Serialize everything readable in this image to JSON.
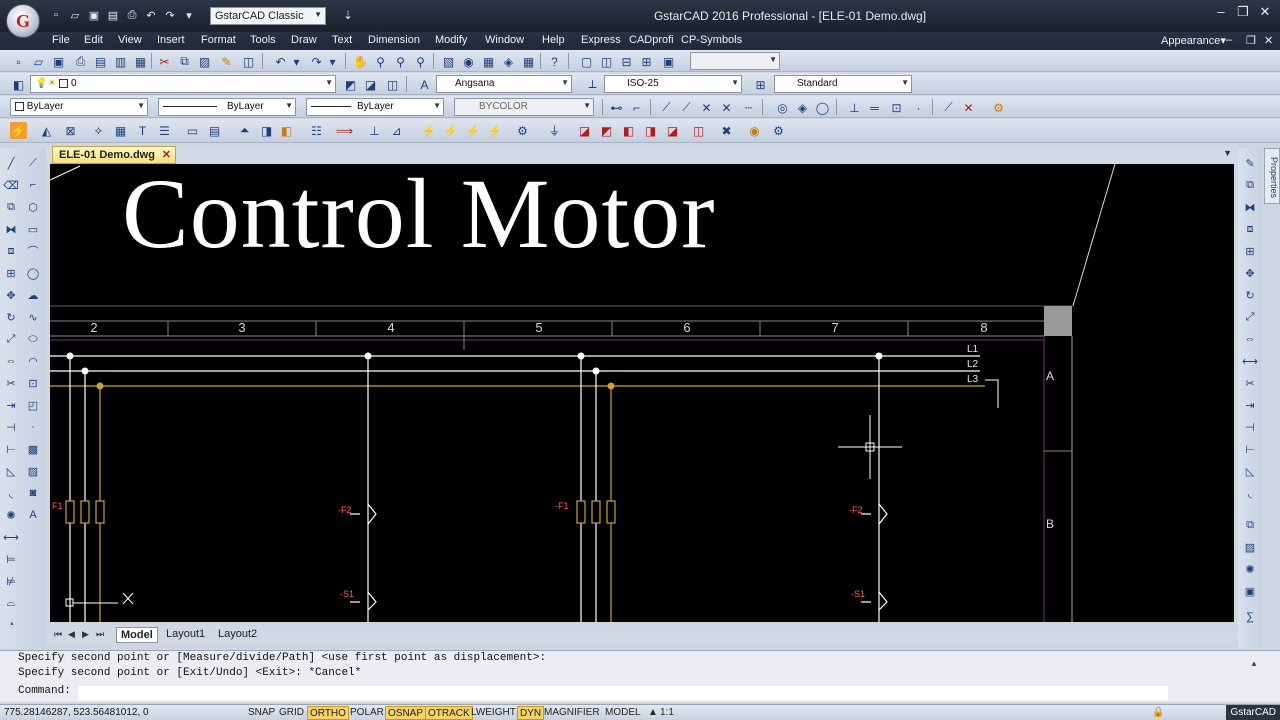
{
  "app": {
    "title": "GstarCAD 2016 Professional - [ELE-01 Demo.dwg]",
    "logo_letter": "G",
    "workspace": "GstarCAD Classic",
    "window_controls": [
      "–",
      "❐",
      "✕"
    ],
    "doc_controls": [
      "–",
      "❐",
      "✕"
    ],
    "appearance_menu": "Appearance▾"
  },
  "menu": [
    "File",
    "Edit",
    "View",
    "Insert",
    "Format",
    "Tools",
    "Draw",
    "Text",
    "Dimension",
    "Modify",
    "Window",
    "Help",
    "Express",
    "CADprofi",
    "CP-Symbols"
  ],
  "toolbar": {
    "layer": "0",
    "text_style": "Angsana",
    "dim_style": "ISO-25",
    "table_style": "Standard",
    "color": "ByLayer",
    "linetype": "ByLayer",
    "lineweight": "ByLayer",
    "plot_style": "BYCOLOR"
  },
  "document_tab": {
    "name": "ELE-01 Demo.dwg",
    "close": "✕"
  },
  "properties_tab": "Properties",
  "drawing": {
    "title": "Control Motor",
    "column_numbers": [
      "2",
      "3",
      "4",
      "5",
      "6",
      "7",
      "8"
    ],
    "row_labels": [
      "A",
      "B"
    ],
    "bus_labels": [
      "L1",
      "L2",
      "L3"
    ],
    "device_tags": [
      "F1",
      "-F2",
      "-F1",
      "-F2",
      "-S1",
      "-S1"
    ]
  },
  "layout_tabs": [
    "Model",
    "Layout1",
    "Layout2"
  ],
  "layout_nav": [
    "⏮",
    "◀",
    "▶",
    "⏭"
  ],
  "command": {
    "history": [
      "Specify second point or [Measure/divide/Path] <use first point as displacement>:",
      "Specify second point or [Exit/Undo] <Exit>: *Cancel*"
    ],
    "prompt": "Command:"
  },
  "status": {
    "coordinates": "775.28146287, 523.56481012, 0",
    "toggles": [
      {
        "label": "SNAP",
        "on": false
      },
      {
        "label": "GRID",
        "on": false
      },
      {
        "label": "ORTHO",
        "on": true
      },
      {
        "label": "POLAR",
        "on": false
      },
      {
        "label": "OSNAP",
        "on": true
      },
      {
        "label": "OTRACK",
        "on": true
      },
      {
        "label": "LWEIGHT",
        "on": false
      },
      {
        "label": "DYN",
        "on": true
      },
      {
        "label": "MAGNIFIER",
        "on": false
      },
      {
        "label": "MODEL",
        "on": false
      }
    ],
    "annotation_scale": "1:1",
    "brand": "GstarCAD"
  },
  "colors": {
    "canvas": "#000000",
    "bus": "#ffffff",
    "phase3": "#c9a23a",
    "device_tag": "#ff5f5f",
    "toggle_on": "#f6d36a"
  }
}
